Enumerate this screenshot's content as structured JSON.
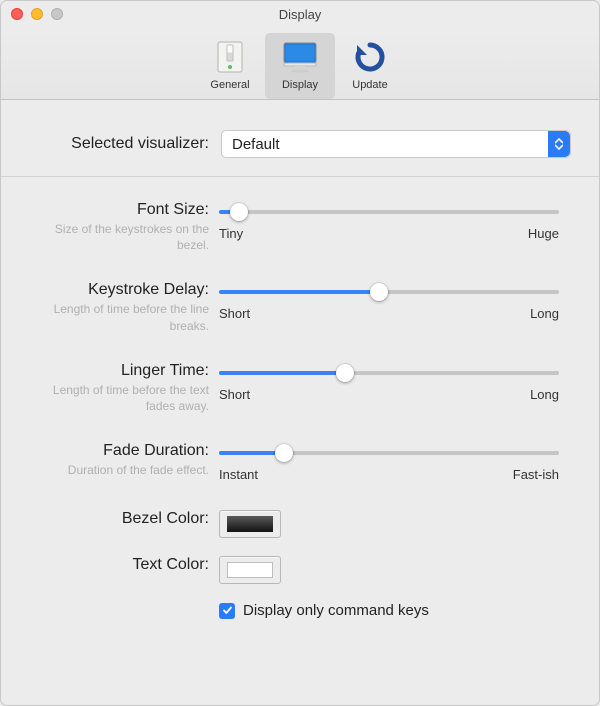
{
  "window": {
    "title": "Display"
  },
  "toolbar": {
    "items": [
      {
        "label": "General"
      },
      {
        "label": "Display"
      },
      {
        "label": "Update"
      }
    ],
    "selected_index": 1
  },
  "visualizer": {
    "label": "Selected visualizer:",
    "value": "Default"
  },
  "sliders": {
    "fontSize": {
      "label": "Font Size:",
      "hint": "Size of the keystrokes on the bezel.",
      "min_label": "Tiny",
      "max_label": "Huge",
      "percent": 6
    },
    "keystrokeDelay": {
      "label": "Keystroke Delay:",
      "hint": "Length of time before the line breaks.",
      "min_label": "Short",
      "max_label": "Long",
      "percent": 47
    },
    "lingerTime": {
      "label": "Linger Time:",
      "hint": "Length of time before the text fades away.",
      "min_label": "Short",
      "max_label": "Long",
      "percent": 37
    },
    "fadeDuration": {
      "label": "Fade Duration:",
      "hint": "Duration of the fade effect.",
      "min_label": "Instant",
      "max_label": "Fast-ish",
      "percent": 19
    }
  },
  "colors": {
    "bezel": {
      "label": "Bezel Color:",
      "value": "#2b2b2b"
    },
    "text": {
      "label": "Text Color:",
      "value": "#ffffff"
    }
  },
  "checkbox": {
    "label": "Display only command keys",
    "checked": true
  }
}
